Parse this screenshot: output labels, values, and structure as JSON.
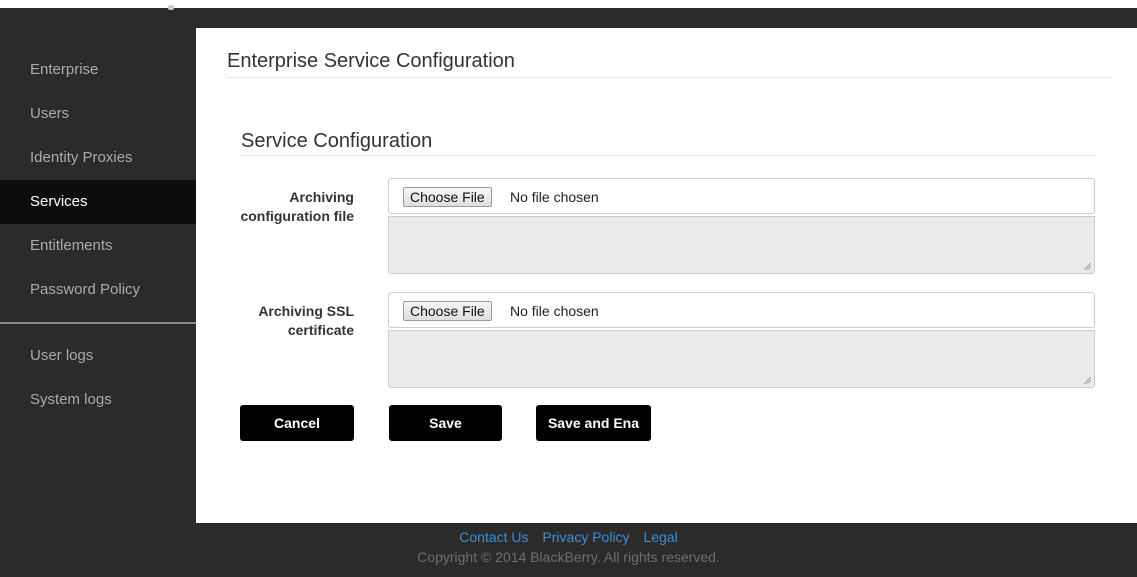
{
  "sidebar": {
    "items": [
      {
        "label": "Enterprise"
      },
      {
        "label": "Users"
      },
      {
        "label": "Identity Proxies"
      },
      {
        "label": "Services"
      },
      {
        "label": "Entitlements"
      },
      {
        "label": "Password Policy"
      },
      {
        "label": "User logs"
      },
      {
        "label": "System logs"
      }
    ],
    "active": "Services"
  },
  "main": {
    "page_title": "Enterprise Service Configuration",
    "section_title": "Service Configuration",
    "fields": [
      {
        "label": "Archiving configuration file",
        "button": "Choose File",
        "status": "No file chosen"
      },
      {
        "label": "Archiving SSL certificate",
        "button": "Choose File",
        "status": "No file chosen"
      }
    ],
    "buttons": {
      "cancel": "Cancel",
      "save": "Save",
      "save_enable": "Save and Ena"
    }
  },
  "footer": {
    "links": [
      "Contact Us",
      "Privacy Policy",
      "Legal"
    ],
    "copyright": "Copyright © 2014 BlackBerry. All rights reserved."
  }
}
